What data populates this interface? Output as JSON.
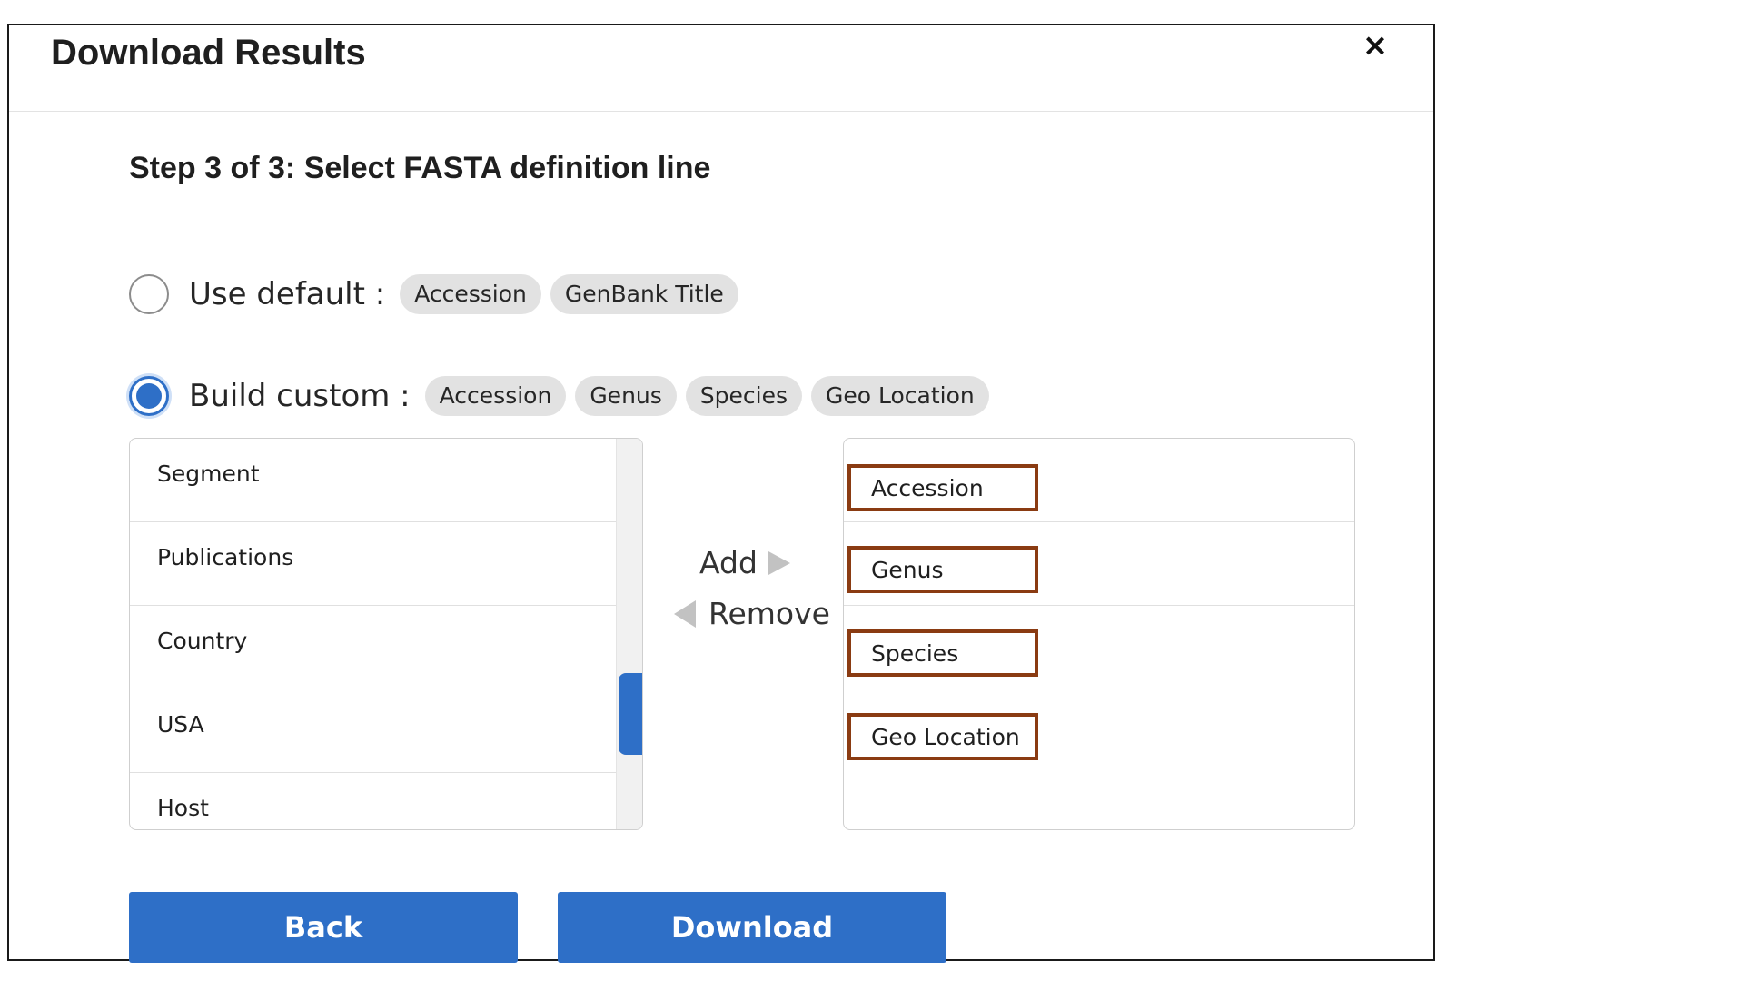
{
  "dialog": {
    "title": "Download Results",
    "close_symbol": "×",
    "step_title": "Step 3 of 3: Select FASTA definition line"
  },
  "options": {
    "default": {
      "label": "Use default :",
      "selected": false,
      "chips": [
        "Accession",
        "GenBank Title"
      ]
    },
    "custom": {
      "label": "Build custom :",
      "selected": true,
      "chips": [
        "Accession",
        "Genus",
        "Species",
        "Geo Location"
      ]
    }
  },
  "available_fields": [
    "Segment",
    "Publications",
    "Country",
    "USA",
    "Host"
  ],
  "selected_fields": [
    "Accession",
    "Genus",
    "Species",
    "Geo Location"
  ],
  "transfer": {
    "add_label": "Add",
    "remove_label": "Remove"
  },
  "buttons": {
    "back_label": "Back",
    "download_label": "Download"
  },
  "colors": {
    "primary": "#2e6fc7",
    "highlight_border": "#8a3b12",
    "chip_bg": "#e2e2e2"
  },
  "icons": {
    "close": "close-icon",
    "add_arrow": "triangle-right-icon",
    "remove_arrow": "triangle-left-icon"
  }
}
